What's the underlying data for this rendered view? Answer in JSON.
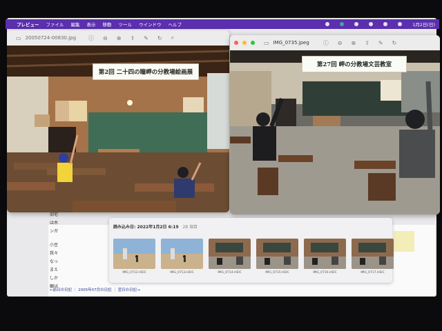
{
  "menubar": {
    "app_name": "プレビュー",
    "items": [
      "ファイル",
      "編集",
      "表示",
      "移動",
      "ツール",
      "ウインドウ",
      "ヘルプ"
    ],
    "datetime": "1月2日(日)"
  },
  "window_left": {
    "title": "20050724-00830.jpg",
    "sign_text": "第2回 二十四の瞳岬の分教場絵画展"
  },
  "window_right": {
    "title": "IMG_0735.jpeg",
    "sign_text": "第27回 岬の分教場文芸教室"
  },
  "import_panel": {
    "header": "読み込み日: 2022年1月2日 6:19",
    "count": "28 項目",
    "items": [
      {
        "name": "IMG_0712.HEIC",
        "kind": "outdoor"
      },
      {
        "name": "IMG_0713.HEIC",
        "kind": "outdoor"
      },
      {
        "name": "IMG_0714.HEIC",
        "kind": "classroom"
      },
      {
        "name": "IMG_0715.HEIC",
        "kind": "classroom"
      },
      {
        "name": "IMG_0716.HEIC",
        "kind": "classroom"
      },
      {
        "name": "IMG_0717.HEIC",
        "kind": "classroom"
      }
    ]
  },
  "background_doc": {
    "lines": [
      "旧宅",
      "は木",
      "ンガ",
      "小豆",
      "我々",
      "なっ",
      "まえ",
      "しか",
      "願は"
    ],
    "links": "←前日の日記 ｜ 2005年07月の日記 ｜ 翌日の日記→"
  },
  "colors": {
    "menubar": "#5b2fae",
    "desk": "#8a5a3a",
    "chalkboard": "#3d6b52"
  }
}
